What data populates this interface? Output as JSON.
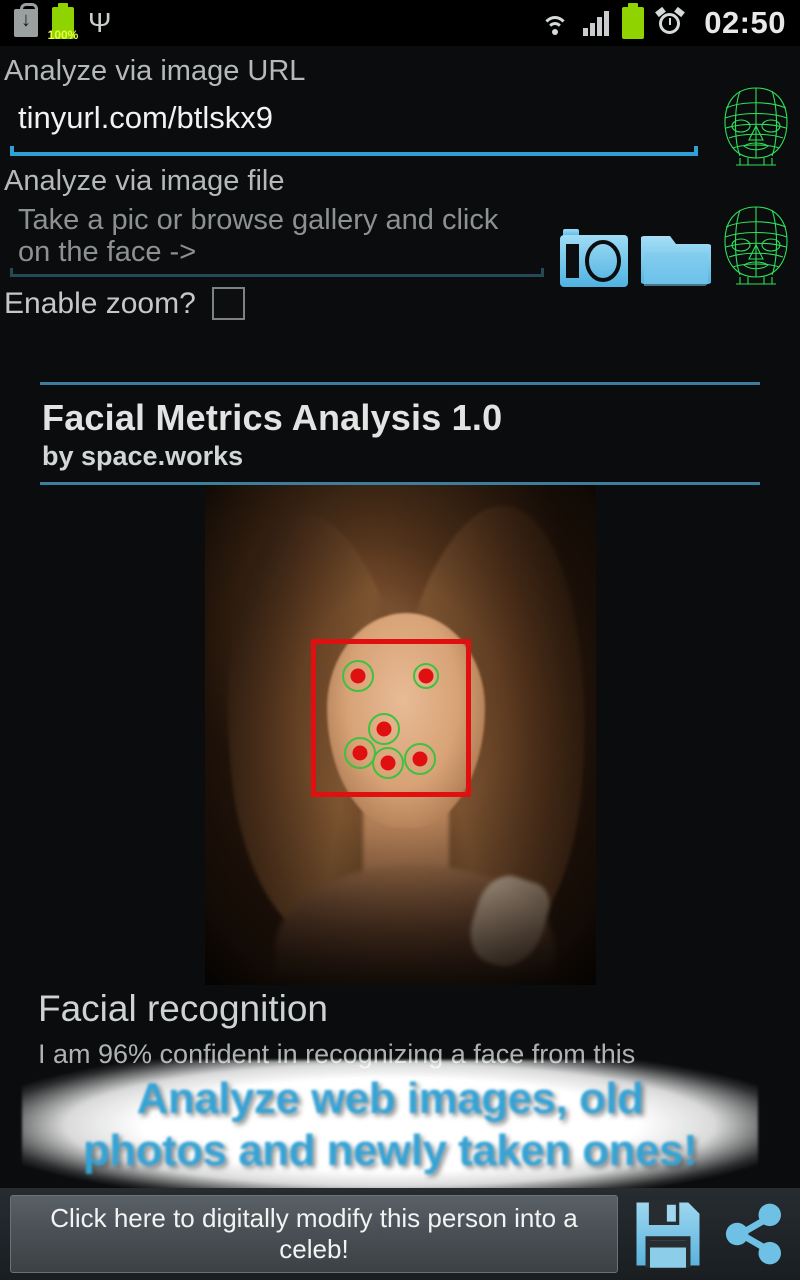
{
  "statusbar": {
    "time": "02:50",
    "battery_percent": "100%",
    "left_icons": [
      "download-icon",
      "battery-icon",
      "usb-icon"
    ],
    "right_icons": [
      "wifi-icon",
      "signal-icon",
      "battery-icon",
      "alarm-icon"
    ]
  },
  "form": {
    "url_label": "Analyze via image URL",
    "url_value": "tinyurl.com/btlskx9",
    "file_label": "Analyze via image file",
    "file_placeholder": "Take a pic or browse gallery and click on the face ->",
    "zoom_label": "Enable zoom?",
    "zoom_checked": false,
    "camera_icon": "camera-icon",
    "folder_icon": "folder-icon",
    "face_icon": "face-wireframe-icon"
  },
  "card": {
    "title": "Facial Metrics Analysis 1.0",
    "subtitle": "by space.works",
    "accent_color": "#3f7d9e"
  },
  "photo": {
    "name": "analyzed-face-photo",
    "detection_box_color": "#e01010",
    "landmark_color": "#3fc13f"
  },
  "results": {
    "heading": "Facial recognition",
    "confidence_text": "I am 96% confident in recognizing a face from this"
  },
  "promo": {
    "line1": "Analyze web images, old",
    "line2": "photos and newly taken ones!",
    "text_color": "#35a3d6"
  },
  "bottombar": {
    "celeb_button": "Click here to digitally modify this person into a celeb!",
    "save_icon": "save-icon",
    "share_icon": "share-icon",
    "icon_color": "#6ec1e4"
  }
}
